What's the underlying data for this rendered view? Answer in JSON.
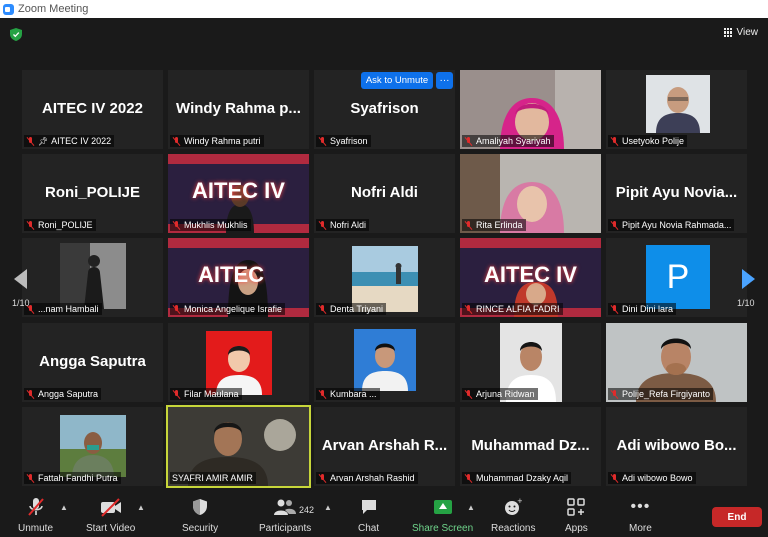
{
  "window": {
    "title": "Zoom Meeting"
  },
  "header": {
    "view_label": "View"
  },
  "pagination": {
    "left": "1/10",
    "right": "1/10"
  },
  "tile_actions": {
    "ask_unmute": "Ask to Unmute",
    "more": "···"
  },
  "participants": [
    {
      "big": "AITEC IV 2022",
      "label": "AITEC IV 2022"
    },
    {
      "big": "Windy  Rahma  p...",
      "label": "Windy Rahma putri"
    },
    {
      "big": "Syafrison",
      "label": "Syafrison"
    },
    {
      "big": "",
      "label": "Amaliyah Syariyah"
    },
    {
      "big": "",
      "label": "Usetyoko Polije"
    },
    {
      "big": "Roni_POLIJE",
      "label": "Roni_POLIJE"
    },
    {
      "big": "AITEC IV",
      "label": "Mukhlis Mukhlis"
    },
    {
      "big": "Nofri Aldi",
      "label": "Nofri Aldi"
    },
    {
      "big": "",
      "label": "Rita Erlinda"
    },
    {
      "big": "Pipit Ayu Novia...",
      "label": "Pipit Ayu Novia Rahmada..."
    },
    {
      "big": "",
      "label": "...nam Hambali"
    },
    {
      "big": "AITEC",
      "label": "Monica Angelique Israfie"
    },
    {
      "big": "",
      "label": "Denta Triyani"
    },
    {
      "big": "AITEC IV",
      "label": "RINCE ALFIA FADRI"
    },
    {
      "big": "P",
      "label": "Dini Dini lara"
    },
    {
      "big": "Angga Saputra",
      "label": "Angga Saputra"
    },
    {
      "big": "",
      "label": "Filar Maulana"
    },
    {
      "big": "",
      "label": "Kumbara ..."
    },
    {
      "big": "",
      "label": "Arjuna Ridwan"
    },
    {
      "big": "",
      "label": "Polije_Refa Firgiyanto"
    },
    {
      "big": "",
      "label": "Fattah Fandhi Putra"
    },
    {
      "big": "",
      "label": "SYAFRI AMIR AMIR"
    },
    {
      "big": "Arvan  Arshah  R...",
      "label": "Arvan Arshah Rashid"
    },
    {
      "big": "Muhammad  Dz...",
      "label": "Muhammad Dzaky Aqil"
    },
    {
      "big": "Adi  wibowo  Bo...",
      "label": "Adi wibowo Bowo"
    }
  ],
  "toolbar": {
    "unmute": "Unmute",
    "start_video": "Start Video",
    "security": "Security",
    "participants": "Participants",
    "participants_count": "242",
    "chat": "Chat",
    "share_screen": "Share Screen",
    "reactions": "Reactions",
    "apps": "Apps",
    "more": "More",
    "end": "End"
  },
  "colors": {
    "accent_blue": "#0e71eb",
    "share_green": "#25a244",
    "end_red": "#c62828",
    "speaker_border": "#c7d63a"
  }
}
